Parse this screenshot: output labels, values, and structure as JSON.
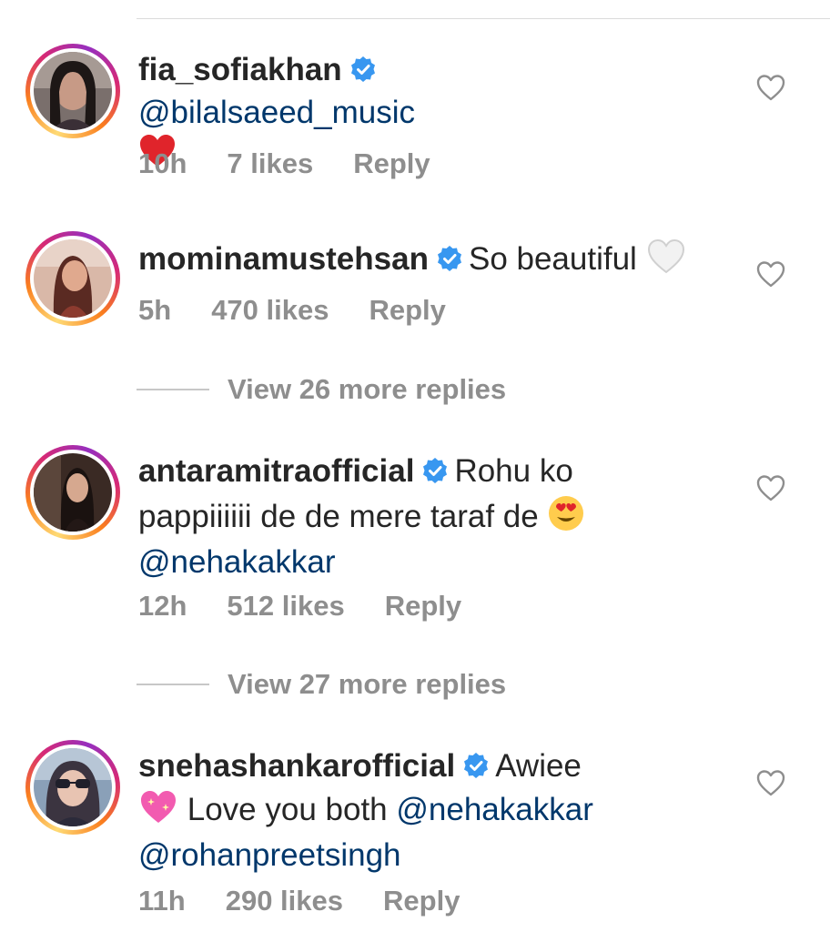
{
  "comments": [
    {
      "username": "fia_sofiakhan",
      "text_before": "",
      "mention": "@bilalsaeed_music",
      "text_after": "",
      "emoji": "red-heart",
      "time": "10h",
      "likes": "7 likes",
      "reply": "Reply"
    },
    {
      "username": "mominamustehsan",
      "text": "So beautiful",
      "emoji": "white-heart",
      "time": "5h",
      "likes": "470 likes",
      "reply": "Reply",
      "view_replies": "View 26 more replies"
    },
    {
      "username": "antaramitraofficial",
      "text_line1": "Rohu ko",
      "text_line2": "pappiiiiii de de mere taraf de",
      "emoji": "heart-eyes",
      "mention": "@nehakakkar",
      "time": "12h",
      "likes": "512 likes",
      "reply": "Reply",
      "view_replies": "View 27 more replies"
    },
    {
      "username": "snehashankarofficial",
      "text_line1": "Awiee",
      "emoji": "sparkling-heart",
      "text_line2": "Love you both",
      "mention1": "@nehakakkar",
      "mention2": "@rohanpreetsingh",
      "time": "11h",
      "likes": "290 likes",
      "reply": "Reply"
    }
  ],
  "colors": {
    "verified": "#3897f0",
    "mention": "#00376b",
    "meta": "#8e8e8e",
    "text": "#262626"
  }
}
